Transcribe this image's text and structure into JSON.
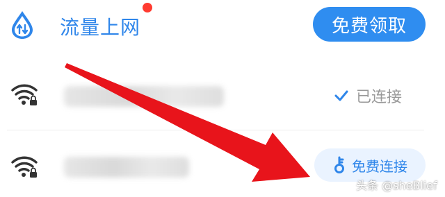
{
  "flow_row": {
    "label": "流量上网",
    "claim_button": "免费领取",
    "notification_dot_color": "#ff3b30"
  },
  "wifi_list": [
    {
      "ssid": "",
      "status_label": "已连接",
      "status": "connected",
      "icon": "wifi-locked-icon"
    },
    {
      "ssid": "",
      "action_label": "免费连接",
      "status": "available",
      "icon": "wifi-locked-icon"
    }
  ],
  "colors": {
    "accent": "#2f86ea",
    "button": "#2f8df0",
    "arrow": "#e8141b"
  },
  "watermark": "头条 @sheBlief"
}
